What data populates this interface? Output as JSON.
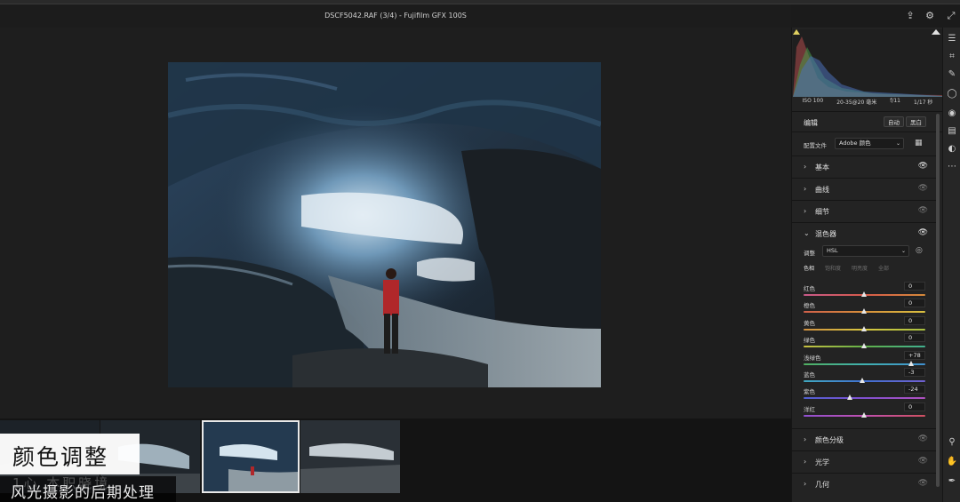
{
  "window": {
    "title": "DSCF5042.RAF (3/4)  -  Fujifilm GFX 100S"
  },
  "toolbar_icons": [
    "share-icon",
    "gear-icon",
    "expand-icon"
  ],
  "exif": [
    "ISO 100",
    "20-35@20 毫米",
    "f/11",
    "1/17 秒"
  ],
  "edit": {
    "title": "编辑",
    "auto_label": "自动",
    "bw_label": "黑白",
    "profile_label": "配置文件",
    "profile_value": "Adobe 颜色"
  },
  "sections_top": [
    {
      "label": "基本"
    },
    {
      "label": "曲线"
    },
    {
      "label": "细节"
    },
    {
      "label": "混色器"
    }
  ],
  "mixer": {
    "adjust_label": "调整",
    "adjust_value": "HSL",
    "subtabs": [
      "色相",
      "饱和度",
      "明亮度",
      "全部"
    ],
    "sliders": [
      {
        "name": "红色",
        "value": "0",
        "level": 0.5
      },
      {
        "name": "橙色",
        "value": "0",
        "level": 0.5
      },
      {
        "name": "黄色",
        "value": "0",
        "level": 0.5
      },
      {
        "name": "绿色",
        "value": "0",
        "level": 0.5
      },
      {
        "name": "浅绿色",
        "value": "+78",
        "level": 0.89
      },
      {
        "name": "蓝色",
        "value": "-3",
        "level": 0.485
      },
      {
        "name": "紫色",
        "value": "-24",
        "level": 0.38
      },
      {
        "name": "洋红",
        "value": "0",
        "level": 0.5
      }
    ]
  },
  "sections_bottom": [
    {
      "label": "颜色分级"
    },
    {
      "label": "光学"
    },
    {
      "label": "几何"
    }
  ],
  "overlay": {
    "caption": "颜色调整",
    "subtitle": "风光摄影的后期处理",
    "watermark": "1心 本职晓境"
  },
  "colors": {
    "panel_bg": "#232323",
    "canvas_bg": "#1e1e1e"
  }
}
